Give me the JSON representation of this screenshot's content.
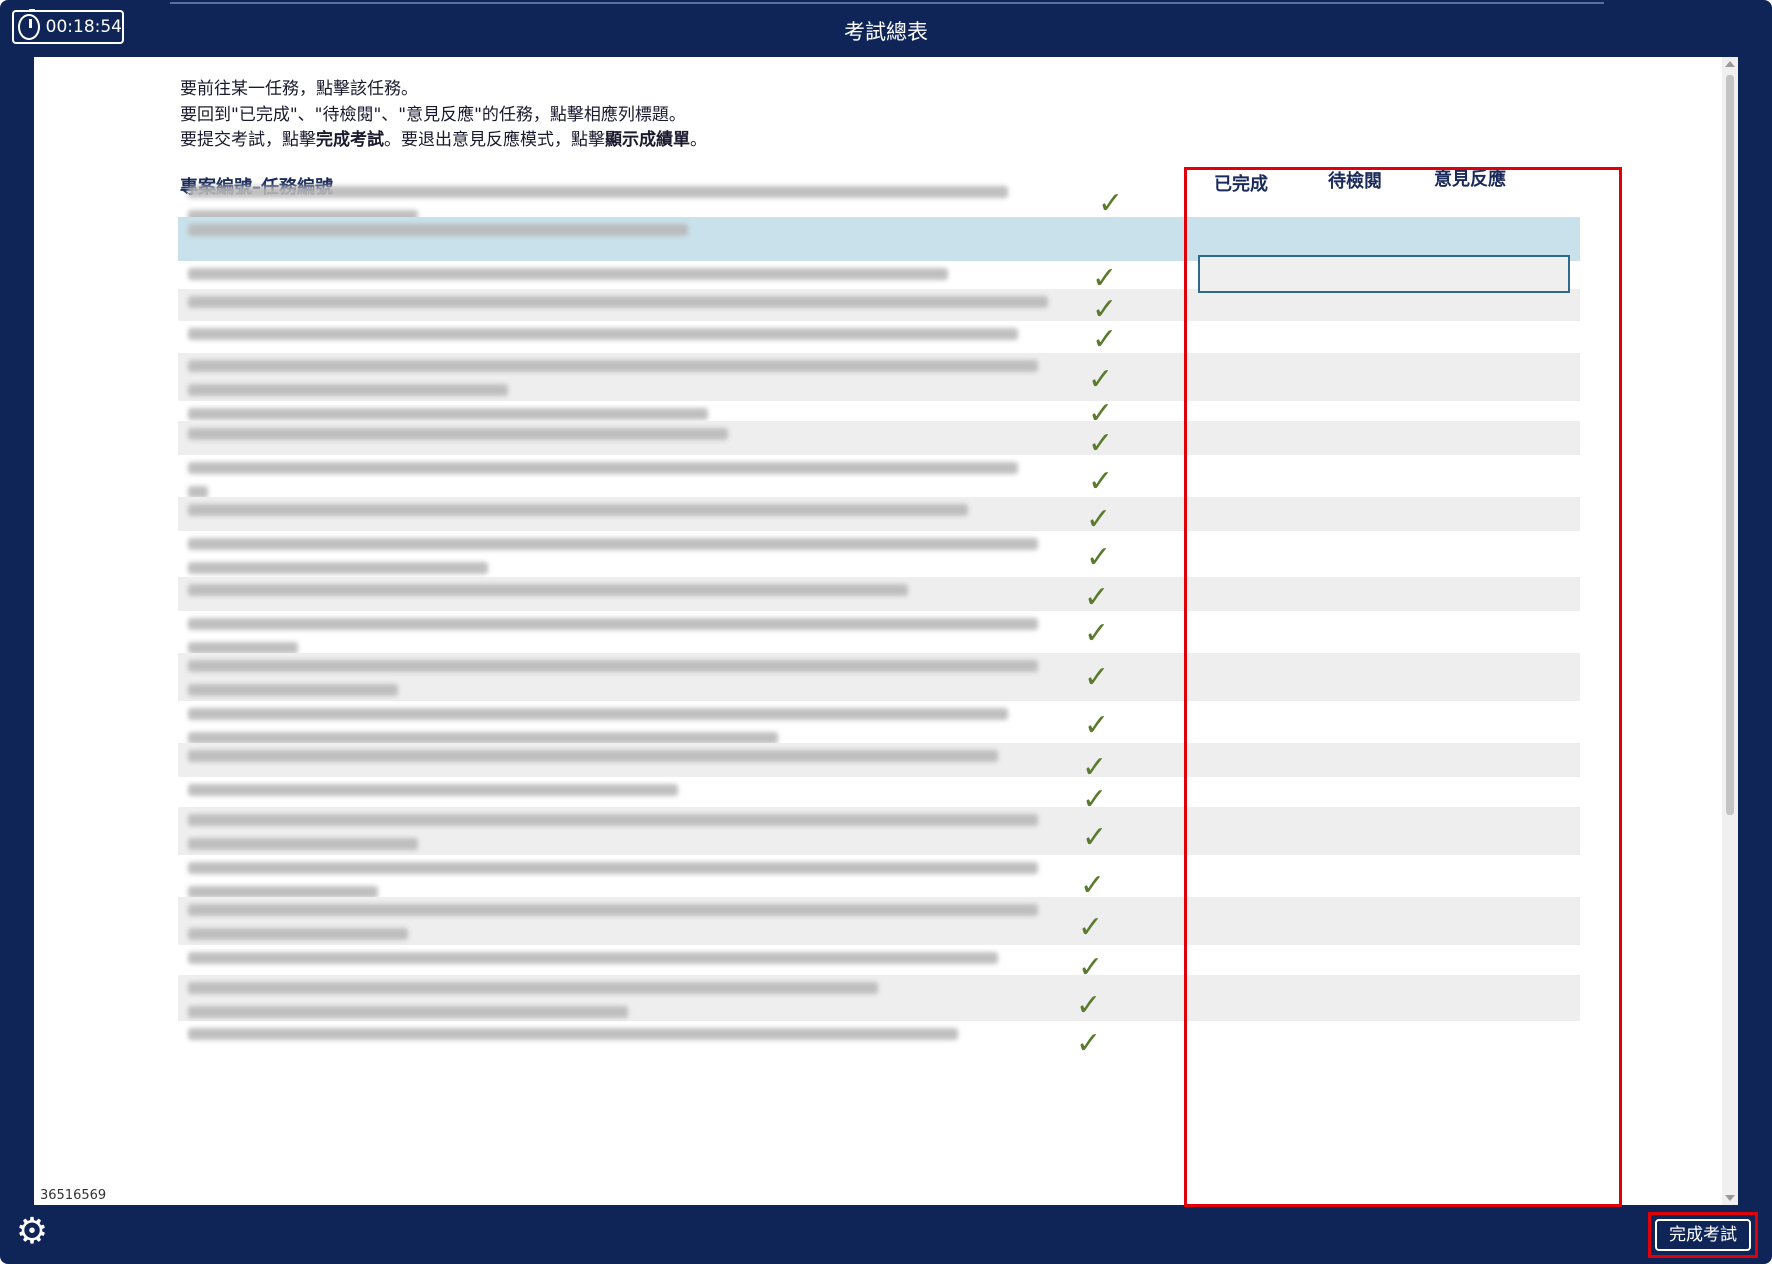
{
  "timer": {
    "time": "00:18:54",
    "icon": "clock-icon"
  },
  "window": {
    "title": "考試總表"
  },
  "instructions": {
    "line1": "要前往某一任務，點擊該任務。",
    "line2": "要回到\"已完成\"、\"待檢閱\"、\"意見反應\"的任務，點擊相應列標題。",
    "line3_a": "要提交考試，點擊",
    "line3_b": "完成考試",
    "line3_c": "。要退出意見反應模式，點擊",
    "line3_d": "顯示成績單",
    "line3_e": "。"
  },
  "table": {
    "header_task": "專案編號–任務編號",
    "header_done": "已完成",
    "header_review": "待檢閱",
    "header_feedback": "意見反應",
    "check_glyph": "✓",
    "rows": [
      {
        "completed": true
      },
      {
        "completed": false,
        "selected": true
      },
      {
        "completed": true
      },
      {
        "completed": true
      },
      {
        "completed": true
      },
      {
        "completed": true
      },
      {
        "completed": true
      },
      {
        "completed": true
      },
      {
        "completed": true
      },
      {
        "completed": true
      },
      {
        "completed": true
      },
      {
        "completed": true
      },
      {
        "completed": true
      },
      {
        "completed": true
      },
      {
        "completed": true
      },
      {
        "completed": true
      },
      {
        "completed": true
      },
      {
        "completed": true
      },
      {
        "completed": true
      },
      {
        "completed": true
      },
      {
        "completed": true
      },
      {
        "completed": true
      },
      {
        "completed": true
      }
    ]
  },
  "footer": {
    "id_number": "36516569",
    "settings_icon": "gear-icon",
    "finish_label": "完成考試"
  },
  "colors": {
    "frame": "#0f2557",
    "highlight": "#e0000a",
    "check": "#5a7a2e",
    "selected_row": "#c8e1ea"
  }
}
